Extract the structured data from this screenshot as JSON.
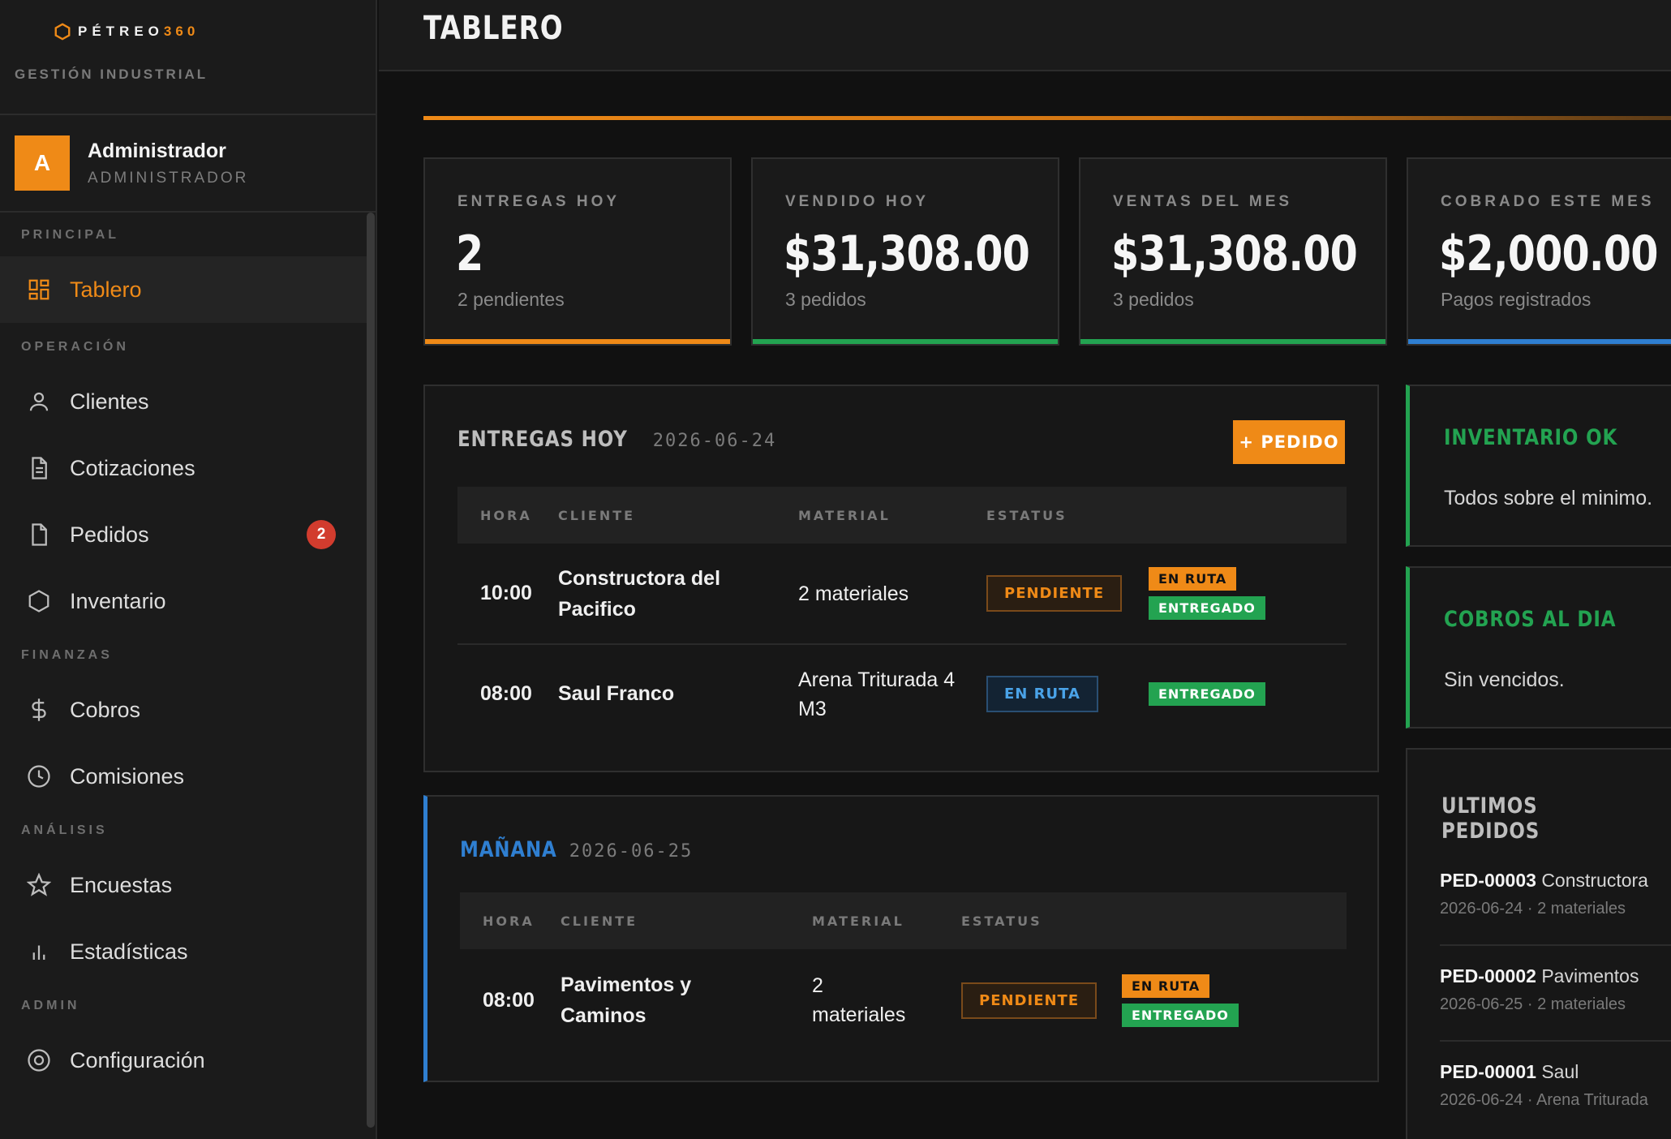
{
  "brand": {
    "name": "PÉTREO",
    "number": "360",
    "subtitle": "GESTIÓN INDUSTRIAL"
  },
  "user": {
    "initial": "A",
    "name": "Administrador",
    "role": "ADMINISTRADOR"
  },
  "nav": {
    "sections": {
      "principal": "PRINCIPAL",
      "operacion": "OPERACIÓN",
      "finanzas": "FINANZAS",
      "analisis": "ANÁLISIS",
      "admin": "ADMIN"
    },
    "items": {
      "tablero": "Tablero",
      "clientes": "Clientes",
      "cotizaciones": "Cotizaciones",
      "pedidos": "Pedidos",
      "pedidos_badge": "2",
      "inventario": "Inventario",
      "cobros": "Cobros",
      "comisiones": "Comisiones",
      "encuestas": "Encuestas",
      "estadisticas": "Estadísticas",
      "configuracion": "Configuración"
    }
  },
  "page": {
    "title": "TABLERO"
  },
  "stats": [
    {
      "label": "ENTREGAS HOY",
      "value": "2",
      "sub": "2 pendientes",
      "color": "#ef8a17"
    },
    {
      "label": "VENDIDO HOY",
      "value": "$31,308.00",
      "sub": "3 pedidos",
      "color": "#23a351"
    },
    {
      "label": "VENTAS DEL MES",
      "value": "$31,308.00",
      "sub": "3 pedidos",
      "color": "#23a351"
    },
    {
      "label": "COBRADO ESTE MES",
      "value": "$2,000.00",
      "sub": "Pagos registrados",
      "color": "#2f7fd1"
    }
  ],
  "today": {
    "title": "ENTREGAS HOY",
    "date": "2026-06-24",
    "button": "+ PEDIDO",
    "headers": {
      "hora": "HORA",
      "cliente": "CLIENTE",
      "material": "MATERIAL",
      "estatus": "ESTATUS"
    },
    "rows": [
      {
        "hora": "10:00",
        "cliente": "Constructora del Pacifico",
        "material": "2 materiales",
        "estatus": "PENDIENTE",
        "chip1": "EN RUTA",
        "chip2": "ENTREGADO"
      },
      {
        "hora": "08:00",
        "cliente": "Saul Franco",
        "material": "Arena Triturada 4 M3",
        "estatus": "EN RUTA",
        "chip2": "ENTREGADO"
      }
    ]
  },
  "tomorrow": {
    "title": "MAÑANA",
    "date": "2026-06-25",
    "headers": {
      "hora": "HORA",
      "cliente": "CLIENTE",
      "material": "MATERIAL",
      "estatus": "ESTATUS"
    },
    "rows": [
      {
        "hora": "08:00",
        "cliente": "Pavimentos y Caminos",
        "material": "2 materiales",
        "estatus": "PENDIENTE",
        "chip1": "EN RUTA",
        "chip2": "ENTREGADO"
      }
    ]
  },
  "inventory": {
    "title": "INVENTARIO OK",
    "text": "Todos sobre el minimo."
  },
  "collections": {
    "title": "COBROS AL DIA",
    "text": "Sin vencidos."
  },
  "orders": {
    "title": "ULTIMOS PEDIDOS",
    "items": [
      {
        "id": "PED-00003",
        "client": "Constructora",
        "meta": "2026-06-24 · 2 materiales"
      },
      {
        "id": "PED-00002",
        "client": "Pavimentos",
        "meta": "2026-06-25 · 2 materiales"
      },
      {
        "id": "PED-00001",
        "client": "Saul",
        "meta": "2026-06-24 · Arena Triturada"
      }
    ]
  },
  "colors": {
    "accent": "#ef8a17",
    "success": "#23a351",
    "info": "#2f7fd1",
    "danger": "#d23c2e"
  }
}
